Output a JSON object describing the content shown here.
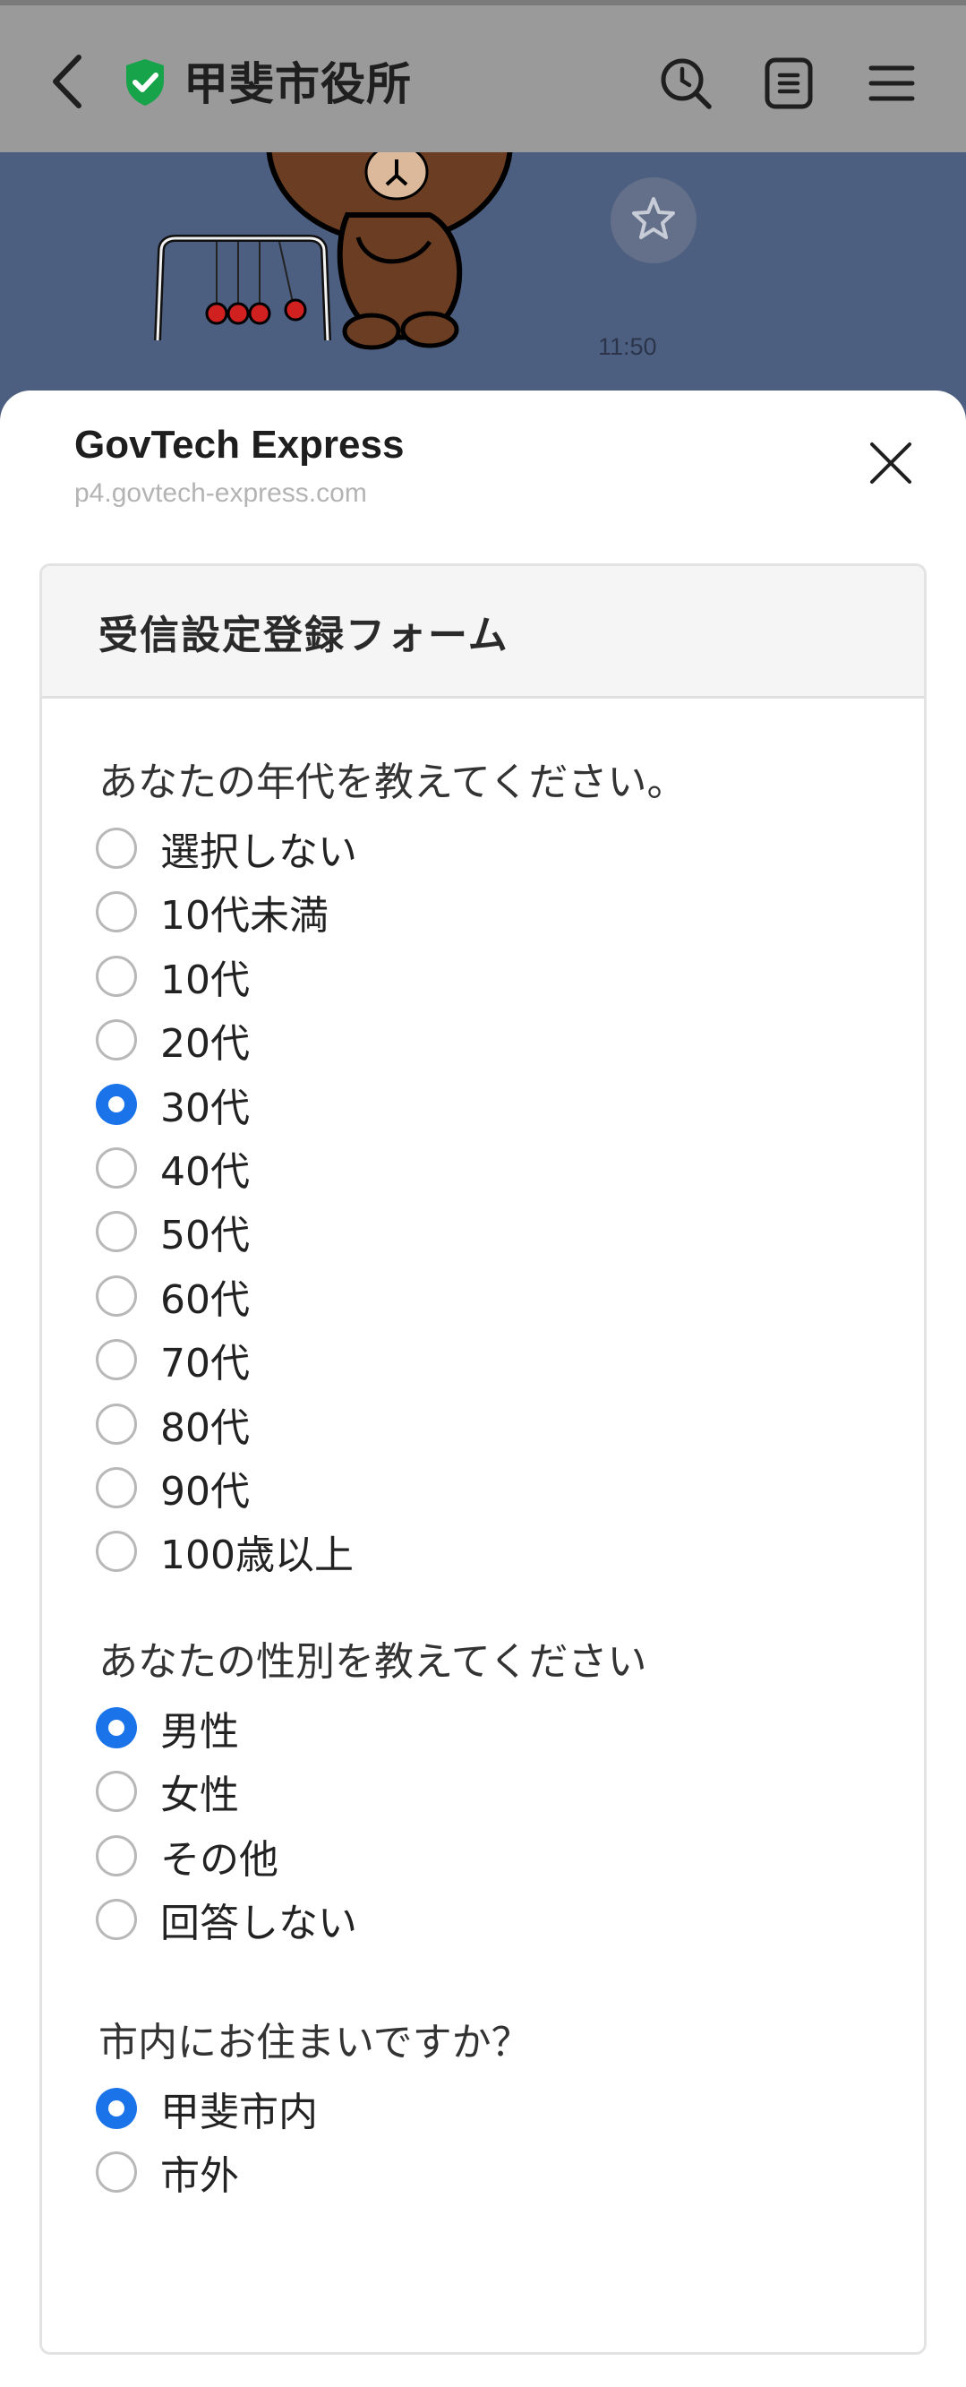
{
  "header": {
    "title": "甲斐市役所",
    "colors": {
      "header_bg": "#9a9a9a",
      "shield": "#16a34a"
    },
    "icons": [
      "back-arrow-icon",
      "verified-shield-icon",
      "search-clock-icon",
      "notes-icon",
      "menu-icon"
    ]
  },
  "chat": {
    "time": "11:50",
    "sticker": "brown-bear-sticker",
    "favorite_icon": "star-icon"
  },
  "sheet": {
    "title": "GovTech Express",
    "url": "p4.govtech-express.com",
    "close_icon": "close-icon"
  },
  "form": {
    "title": "受信設定登録フォーム",
    "accent": "#1a73e8",
    "questions": [
      {
        "label": "あなたの年代を教えてください。",
        "options": [
          "選択しない",
          "10代未満",
          "10代",
          "20代",
          "30代",
          "40代",
          "50代",
          "60代",
          "70代",
          "80代",
          "90代",
          "100歳以上"
        ],
        "selected": "30代"
      },
      {
        "label": "あなたの性別を教えてください",
        "options": [
          "男性",
          "女性",
          "その他",
          "回答しない"
        ],
        "selected": "男性"
      },
      {
        "label": "市内にお住まいですか？",
        "options": [
          "甲斐市内",
          "市外"
        ],
        "selected": "甲斐市内"
      }
    ]
  }
}
